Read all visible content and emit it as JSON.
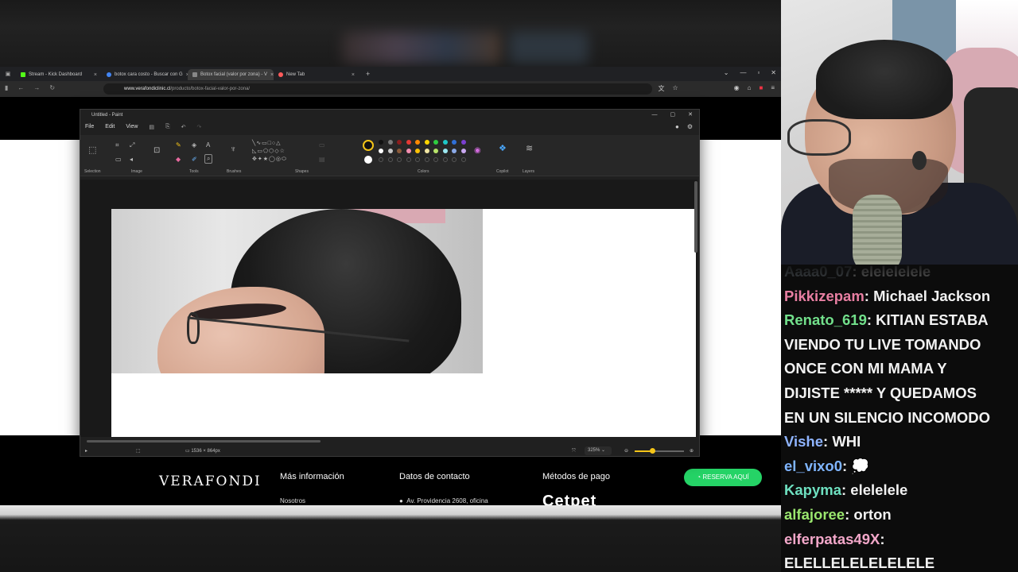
{
  "browser": {
    "tabs": [
      {
        "label": "Stream - Kick Dashboard",
        "color": "#53fc18",
        "active": false
      },
      {
        "label": "botox cara costo - Buscar con G",
        "color": "#4285f4",
        "active": false
      },
      {
        "label": "Botox facial (valor por zona) - V",
        "color": "#888888",
        "active": true
      },
      {
        "label": "New Tab",
        "color": "#ff5b5b",
        "active": false
      }
    ],
    "address_host": "www.verafondiclinic.cl",
    "address_path": "/producto/botox-facial-valor-por-zona/"
  },
  "website": {
    "logo": "VERAFONDI",
    "col1_title": "Más información",
    "col1_item": "Nosotros",
    "col2_title": "Datos de contacto",
    "col2_item": "Av. Providencia 2608, oficina",
    "col3_title": "Métodos de pago",
    "col3_item": "Cetpet",
    "cta": "RESERVA AQUÍ"
  },
  "paint": {
    "title": "Untitled - Paint",
    "menu": [
      "File",
      "Edit",
      "View"
    ],
    "groups": [
      "Selection",
      "Image",
      "Tools",
      "Brushes",
      "Shapes",
      "Colors",
      "Copilot",
      "Layers"
    ],
    "canvas_size": "1536 × 864px",
    "zoom": "325%",
    "zoom_fraction": 0.35
  },
  "chat": {
    "messages": [
      {
        "user": "Aaaa0_07",
        "text": "elelelelele",
        "color": "#9aa6b2"
      },
      {
        "user": "Pikkizepam",
        "text": "Michael Jackson",
        "color": "#e87fa2"
      },
      {
        "user": "Renato_619",
        "text": "KITIAN ESTABA",
        "color": "#72e08b"
      },
      {
        "user": "",
        "text": "VIENDO TU LIVE TOMANDO",
        "color": "#ffffff"
      },
      {
        "user": "",
        "text": "ONCE CON MI MAMA Y",
        "color": "#ffffff"
      },
      {
        "user": "",
        "text": "DIJISTE ***** Y QUEDAMOS",
        "color": "#ffffff"
      },
      {
        "user": "",
        "text": "EN UN SILENCIO INCOMODO",
        "color": "#ffffff"
      },
      {
        "user": "Vishe",
        "text": "WHI",
        "color": "#8fb4ff"
      },
      {
        "user": "el_vixo0",
        "text": "💭",
        "color": "#7fb5ff"
      },
      {
        "user": "Kapyma",
        "text": "elelelele",
        "color": "#6ee0c0"
      },
      {
        "user": "alfajoree",
        "text": "orton",
        "color": "#9ae66e"
      },
      {
        "user": "elferpatas49X",
        "text": "",
        "color": "#f2a7c9"
      },
      {
        "user": "",
        "text": "ELELLELELELELELE",
        "color": "#ffffff"
      }
    ]
  }
}
